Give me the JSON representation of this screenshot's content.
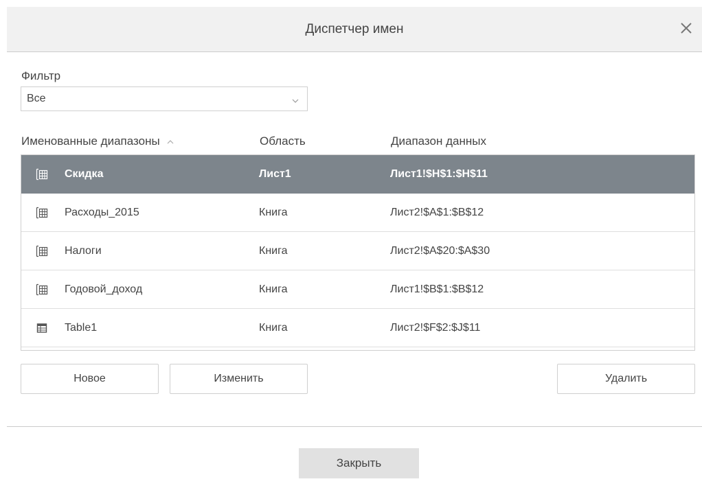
{
  "dialog": {
    "title": "Диспетчер имен",
    "close_icon": "close-icon"
  },
  "filter": {
    "label": "Фильтр",
    "selected": "Все",
    "icon": "chevron-down-icon"
  },
  "columns": {
    "name": "Именованные диапазоны",
    "name_sort_icon": "sort-ascending-icon",
    "scope": "Область",
    "range": "Диапазон данных"
  },
  "rows": [
    {
      "icon": "named-range-icon",
      "name": "Скидка",
      "scope": "Лист1",
      "range": "Лист1!$H$1:$H$11",
      "selected": true
    },
    {
      "icon": "named-range-icon",
      "name": "Расходы_2015",
      "scope": "Книга",
      "range": "Лист2!$A$1:$B$12",
      "selected": false
    },
    {
      "icon": "named-range-icon",
      "name": "Налоги",
      "scope": "Книга",
      "range": "Лист2!$A$20:$A$30",
      "selected": false
    },
    {
      "icon": "named-range-icon",
      "name": "Годовой_доход",
      "scope": "Книга",
      "range": "Лист1!$B$1:$B$12",
      "selected": false
    },
    {
      "icon": "table-icon",
      "name": "Table1",
      "scope": "Книга",
      "range": "Лист2!$F$2:$J$11",
      "selected": false
    }
  ],
  "buttons": {
    "new": "Новое",
    "edit": "Изменить",
    "delete": "Удалить",
    "close": "Закрыть"
  },
  "colors": {
    "title_bar": "#f1f1f1",
    "selected_row": "#7d858c",
    "close_button": "#e1e1e1",
    "border": "#cfcfcf"
  }
}
